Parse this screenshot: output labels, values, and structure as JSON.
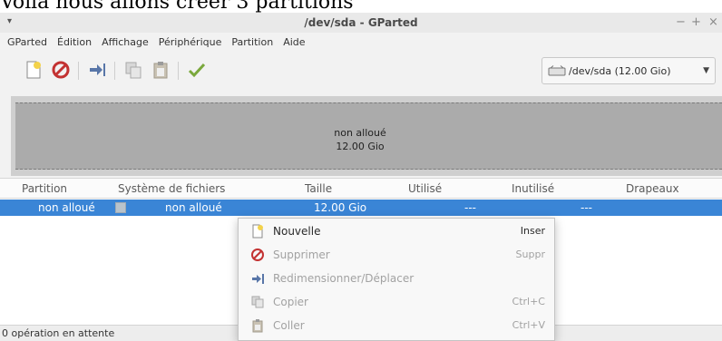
{
  "caption": "Voila nous allons créer 3 partitions",
  "window": {
    "title": "/dev/sda - GParted",
    "menu_glyph": "▾",
    "controls": {
      "minimize": "−",
      "maximize": "+",
      "close": "×"
    }
  },
  "menubar": [
    "GParted",
    "Édition",
    "Affichage",
    "Périphérique",
    "Partition",
    "Aide"
  ],
  "toolbar": {
    "icons": [
      "new-icon",
      "delete-icon",
      "resize-move-icon",
      "copy-icon",
      "paste-icon",
      "apply-icon"
    ],
    "device": {
      "label": "/dev/sda  (12.00 Gio)",
      "icon": "drive-icon"
    }
  },
  "disk_map": {
    "label": "non alloué",
    "size": "12.00 Gio"
  },
  "table": {
    "columns": [
      "Partition",
      "Système de fichiers",
      "Taille",
      "Utilisé",
      "Inutilisé",
      "Drapeaux"
    ],
    "rows": [
      {
        "partition": "non alloué",
        "filesystem": "non alloué",
        "size": "12.00 Gio",
        "used": "---",
        "unused": "---",
        "flags": ""
      }
    ]
  },
  "status": "0 opération en attente",
  "context_menu": {
    "items": [
      {
        "label": "Nouvelle",
        "accel": "Inser",
        "enabled": true,
        "icon": "new-icon"
      },
      {
        "label": "Supprimer",
        "accel": "Suppr",
        "enabled": false,
        "icon": "delete-icon"
      },
      {
        "label": "Redimensionner/Déplacer",
        "accel": "",
        "enabled": false,
        "icon": "resize-move-icon"
      },
      {
        "label": "Copier",
        "accel": "Ctrl+C",
        "enabled": false,
        "icon": "copy-icon"
      },
      {
        "label": "Coller",
        "accel": "Ctrl+V",
        "enabled": false,
        "icon": "paste-icon"
      }
    ]
  },
  "colors": {
    "selection": "#3a85d6",
    "unallocated": "#ababab",
    "delete": "#c33232",
    "apply": "#7aa83c"
  }
}
